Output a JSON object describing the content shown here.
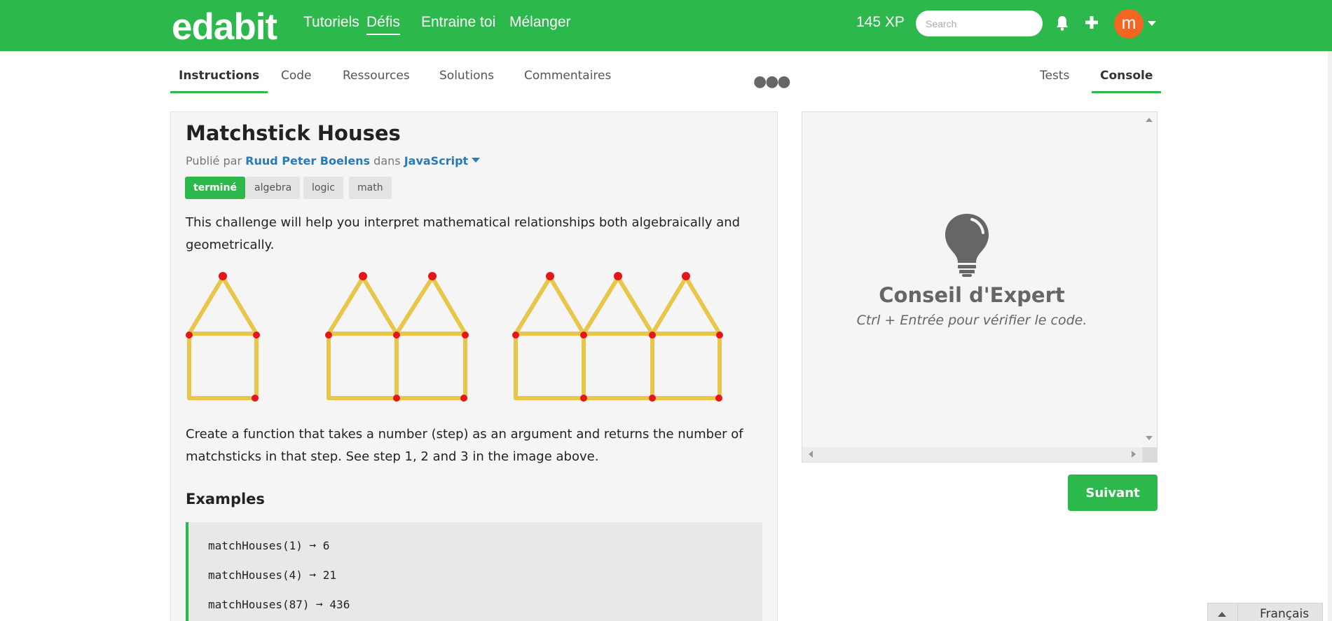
{
  "header": {
    "logo": "edabit",
    "nav": [
      "Tutoriels",
      "Défis",
      "Entraine toi",
      "Mélanger"
    ],
    "active_nav": "Défis",
    "xp": "145 XP",
    "search_placeholder": "Search",
    "avatar_letter": "m"
  },
  "tabs": {
    "left": [
      "Instructions",
      "Code",
      "Ressources",
      "Solutions",
      "Commentaires"
    ],
    "right": [
      "Tests",
      "Console"
    ],
    "active_left": "Instructions",
    "active_right": "Console"
  },
  "challenge": {
    "title": "Matchstick Houses",
    "published_by": "Publié par",
    "author": "Ruud Peter Boelens",
    "in_label": "dans",
    "language": "JavaScript",
    "tags": [
      "terminé",
      "algebra",
      "logic",
      "math"
    ],
    "intro": "This challenge will help you interpret mathematical relationships both algebraically and geometrically.",
    "description": "Create a function that takes a number (step) as an argument and returns the number of matchsticks in that step. See step 1, 2 and 3 in the image above.",
    "examples_heading": "Examples",
    "examples": [
      {
        "call": "matchHouses(1)",
        "arrow": "➞",
        "result": "6"
      },
      {
        "call": "matchHouses(4)",
        "arrow": "➞",
        "result": "21"
      },
      {
        "call": "matchHouses(87)",
        "arrow": "➞",
        "result": "436"
      }
    ]
  },
  "console": {
    "tip_title": "Conseil d'Expert",
    "tip_text": "Ctrl + Entrée pour vérifier le code.",
    "next_button": "Suivant"
  },
  "language_widget": {
    "label": "Français"
  },
  "colors": {
    "brand_green": "#2db84b",
    "link_blue": "#2a7ab8",
    "avatar_orange": "#f26522"
  }
}
